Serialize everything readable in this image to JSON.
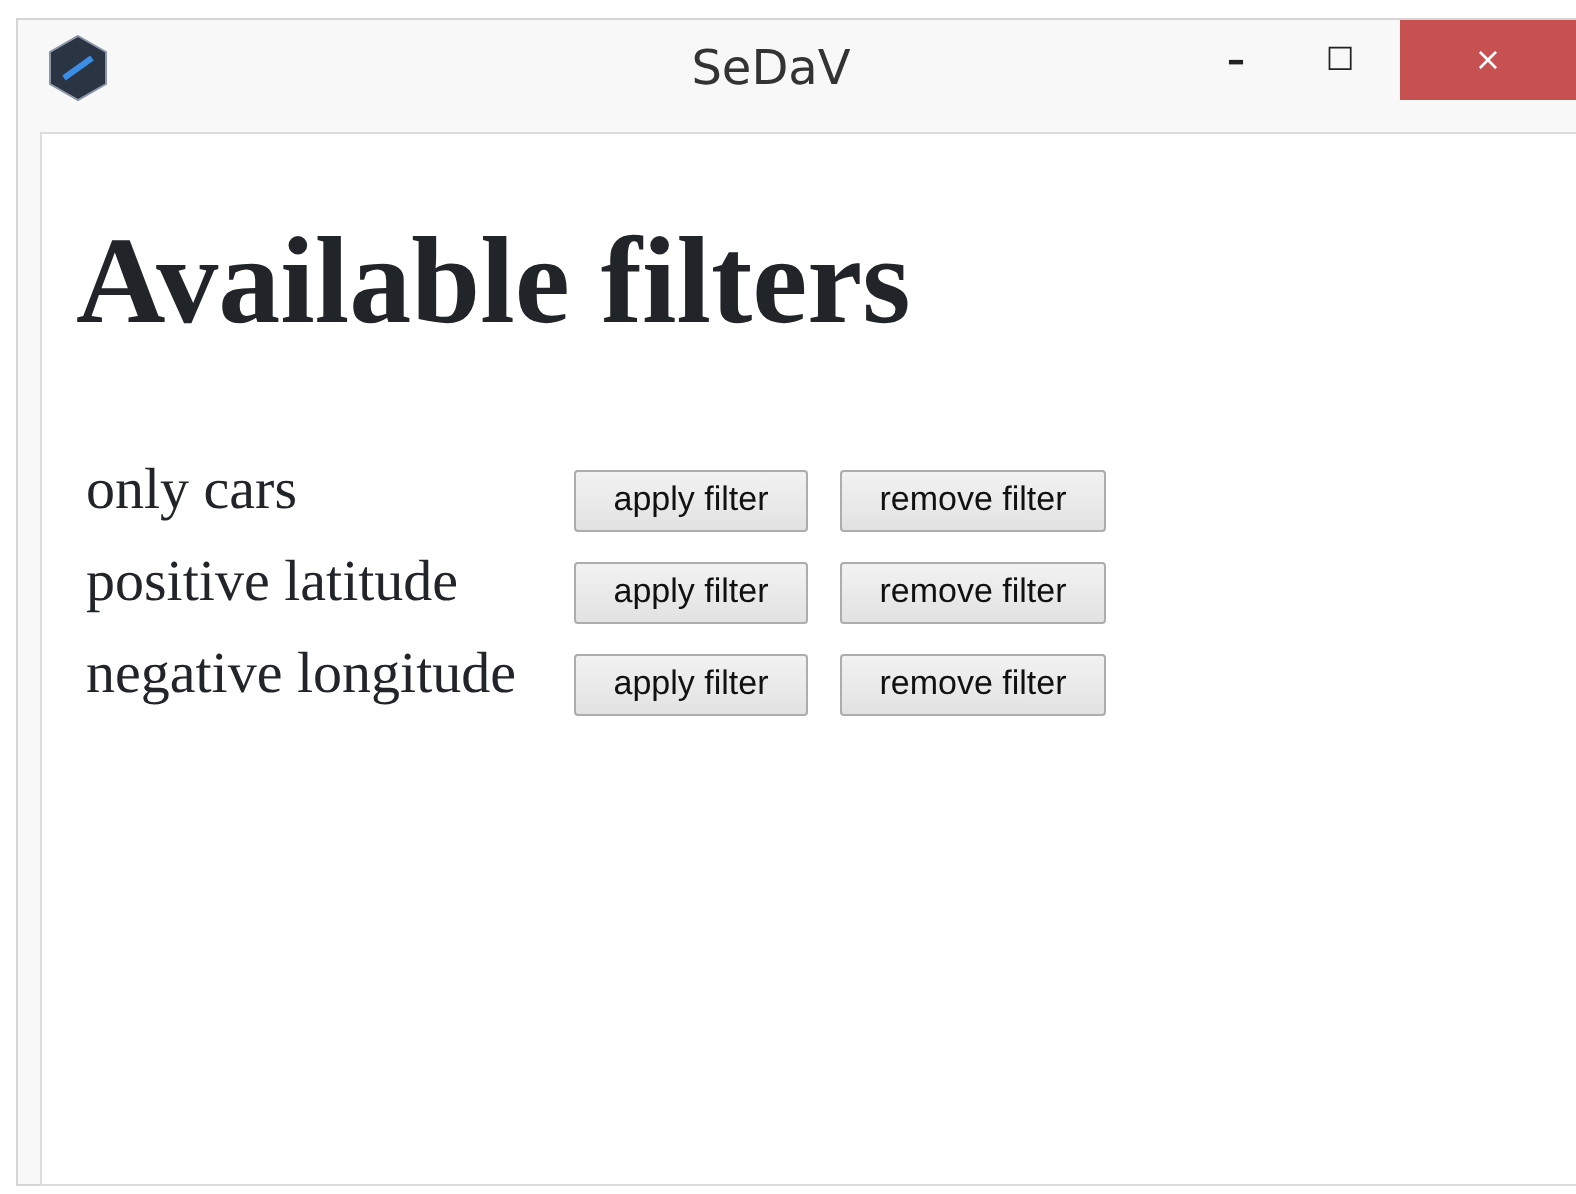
{
  "window": {
    "title": "SeDaV",
    "buttons": [
      "–",
      "☐",
      "×"
    ]
  },
  "heading": "Available filters",
  "filters": [
    {
      "label": "only cars",
      "buttons": [
        "apply filter",
        "remove filter"
      ]
    },
    {
      "label": "positive latitude",
      "buttons": [
        "apply filter",
        "remove filter"
      ]
    },
    {
      "label": "negative longitude",
      "buttons": [
        "apply filter",
        "remove filter"
      ]
    }
  ]
}
